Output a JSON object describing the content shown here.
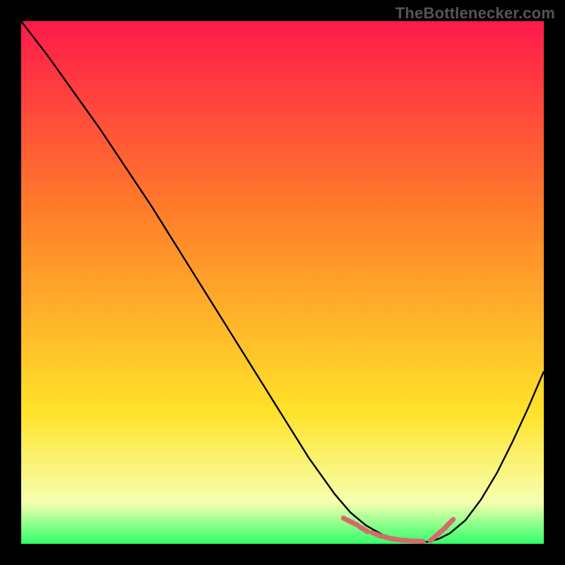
{
  "watermark": "TheBottlenecker.com",
  "chart_data": {
    "type": "line",
    "title": "",
    "xlabel": "",
    "ylabel": "",
    "xlim": [
      0,
      1
    ],
    "ylim": [
      0,
      1
    ],
    "background_gradient": {
      "top_color": "#ff1a4b",
      "mid_color_1": "#ff7a2a",
      "mid_color_2": "#ffe32a",
      "bottom_color": "#31ff6a",
      "stops": [
        0.0,
        0.35,
        0.75,
        0.92,
        1.0
      ]
    },
    "series": [
      {
        "name": "bottleneck-curve",
        "color": "#000000",
        "x": [
          0.0,
          0.05,
          0.1,
          0.15,
          0.2,
          0.25,
          0.3,
          0.35,
          0.4,
          0.45,
          0.5,
          0.55,
          0.6,
          0.63,
          0.66,
          0.69,
          0.72,
          0.75,
          0.78,
          0.8,
          0.82,
          0.85,
          0.88,
          0.91,
          0.94,
          0.97,
          1.0
        ],
        "y": [
          1.0,
          0.935,
          0.865,
          0.795,
          0.72,
          0.645,
          0.565,
          0.485,
          0.405,
          0.325,
          0.245,
          0.165,
          0.095,
          0.06,
          0.035,
          0.018,
          0.008,
          0.003,
          0.004,
          0.01,
          0.02,
          0.045,
          0.085,
          0.135,
          0.195,
          0.26,
          0.33
        ]
      },
      {
        "name": "highlight-dashes-left",
        "color": "#d46a6a",
        "style": "dotted_segments",
        "x": [
          0.625,
          0.635,
          0.655,
          0.68,
          0.7,
          0.72,
          0.74,
          0.76
        ],
        "y": [
          0.045,
          0.04,
          0.028,
          0.018,
          0.012,
          0.008,
          0.006,
          0.005
        ]
      },
      {
        "name": "highlight-dashes-right",
        "color": "#d46a6a",
        "style": "dotted_segments",
        "x": [
          0.79,
          0.805,
          0.82
        ],
        "y": [
          0.012,
          0.025,
          0.04
        ]
      }
    ]
  }
}
